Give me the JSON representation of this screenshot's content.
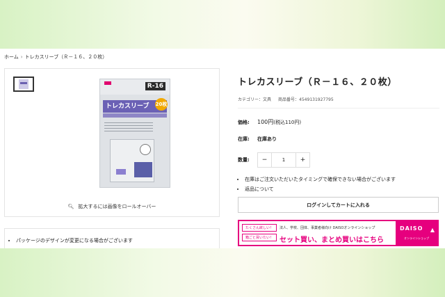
{
  "breadcrumb": {
    "home": "ホーム",
    "separator": "›",
    "current": "トレカスリーブ（Ｒ－１６、２０枚）"
  },
  "product_image": {
    "code": "R-16",
    "name": "トレカスリーブ",
    "badge": "20枚"
  },
  "gallery": {
    "zoom_hint": "拡大するには画像をロールオーバー"
  },
  "product": {
    "title": "トレカスリーブ（Ｒ－１６、２０枚）",
    "category_label": "カテゴリー：",
    "category_value": "文具",
    "item_number_label": "商品番号：",
    "item_number": "4549131927795",
    "price_label": "価格:",
    "price": "100円",
    "price_tax": "(税込110円)",
    "stock_label": "在庫:",
    "stock_value": "在庫あり",
    "qty_label": "数量:",
    "qty_minus": "−",
    "qty_value": "1",
    "qty_plus": "+"
  },
  "notices": [
    "在庫はご注文いただいたタイミングで確保できない場合がございます",
    "返品について"
  ],
  "cart_button": "ログインしてカートに入れる",
  "banner": {
    "tag1": "たくさん欲しい！",
    "tag2": "箱ごと買いたい！",
    "line1": "法人、学校、団体、事業者様向け DAISOオンラインショップ",
    "line2": "セット買い、まとめ買いはこちら",
    "brand": "DAISO",
    "brand_sub": "オンラインショップ"
  },
  "package_notes": [
    "パッケージのデザインが変更になる場合がございます"
  ],
  "colors": {
    "accent": "#e6007e",
    "package_purple": "#6b61b5"
  }
}
